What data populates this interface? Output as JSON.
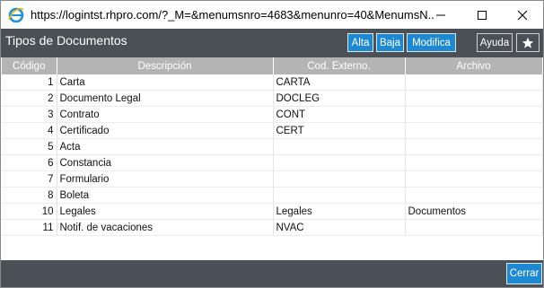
{
  "window": {
    "url": "https://logintst.rhpro.com/?_M=&menumsnro=4683&menunro=40&MenumsN..."
  },
  "app": {
    "title": "Tipos de Documentos"
  },
  "toolbar": {
    "alta": "Alta",
    "baja": "Baja",
    "modifica": "Modifica",
    "ayuda": "Ayuda"
  },
  "table": {
    "headers": [
      "Código",
      "Descripción",
      "Cod. Externo.",
      "Archivo"
    ],
    "rows": [
      {
        "codigo": "1",
        "descripcion": "Carta",
        "externo": "CARTA",
        "archivo": ""
      },
      {
        "codigo": "2",
        "descripcion": "Documento Legal",
        "externo": "DOCLEG",
        "archivo": ""
      },
      {
        "codigo": "3",
        "descripcion": "Contrato",
        "externo": "CONT",
        "archivo": ""
      },
      {
        "codigo": "4",
        "descripcion": "Certificado",
        "externo": "CERT",
        "archivo": ""
      },
      {
        "codigo": "5",
        "descripcion": "Acta",
        "externo": "",
        "archivo": ""
      },
      {
        "codigo": "6",
        "descripcion": "Constancia",
        "externo": "",
        "archivo": ""
      },
      {
        "codigo": "7",
        "descripcion": "Formulario",
        "externo": "",
        "archivo": ""
      },
      {
        "codigo": "8",
        "descripcion": "Boleta",
        "externo": "",
        "archivo": ""
      },
      {
        "codigo": "10",
        "descripcion": "Legales",
        "externo": "Legales",
        "archivo": "Documentos"
      },
      {
        "codigo": "11",
        "descripcion": "Notif. de vacaciones",
        "externo": "NVAC",
        "archivo": ""
      }
    ]
  },
  "footer": {
    "cerrar": "Cerrar"
  },
  "colors": {
    "header_bg": "#4b5056",
    "button_blue": "#1e88d0",
    "table_header_bg": "#b4b4b4"
  }
}
